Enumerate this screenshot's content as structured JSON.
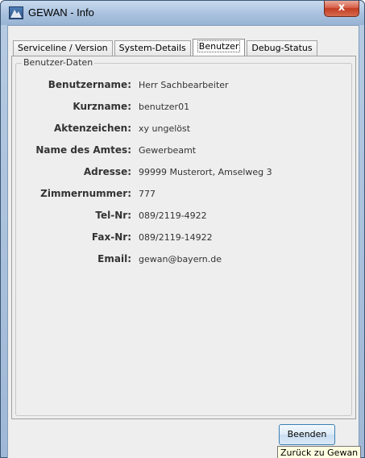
{
  "window": {
    "title": "GEWAN - Info",
    "close_symbol": "x"
  },
  "tabs": [
    {
      "label": "Serviceline / Version",
      "active": false
    },
    {
      "label": "System-Details",
      "active": false
    },
    {
      "label": "Benutzer",
      "active": true
    },
    {
      "label": "Debug-Status",
      "active": false
    }
  ],
  "group": {
    "legend": "Benutzer-Daten",
    "fields": [
      {
        "label": "Benutzername:",
        "value": "Herr Sachbearbeiter"
      },
      {
        "label": "Kurzname:",
        "value": "benutzer01"
      },
      {
        "label": "Aktenzeichen:",
        "value": "xy ungelöst"
      },
      {
        "label": "Name des Amtes:",
        "value": "Gewerbeamt"
      },
      {
        "label": "Adresse:",
        "value": "99999 Musterort, Amselweg 3"
      },
      {
        "label": "Zimmernummer:",
        "value": "777"
      },
      {
        "label": "Tel-Nr:",
        "value": "089/2119-4922"
      },
      {
        "label": "Fax-Nr:",
        "value": "089/2119-14922"
      },
      {
        "label": "Email:",
        "value": "gewan@bayern.de"
      }
    ]
  },
  "footer": {
    "close_button_label": "Beenden",
    "tooltip": "Zurück zu Gewan"
  },
  "icons": {
    "app": "gewan-app-icon",
    "close": "close-icon"
  }
}
